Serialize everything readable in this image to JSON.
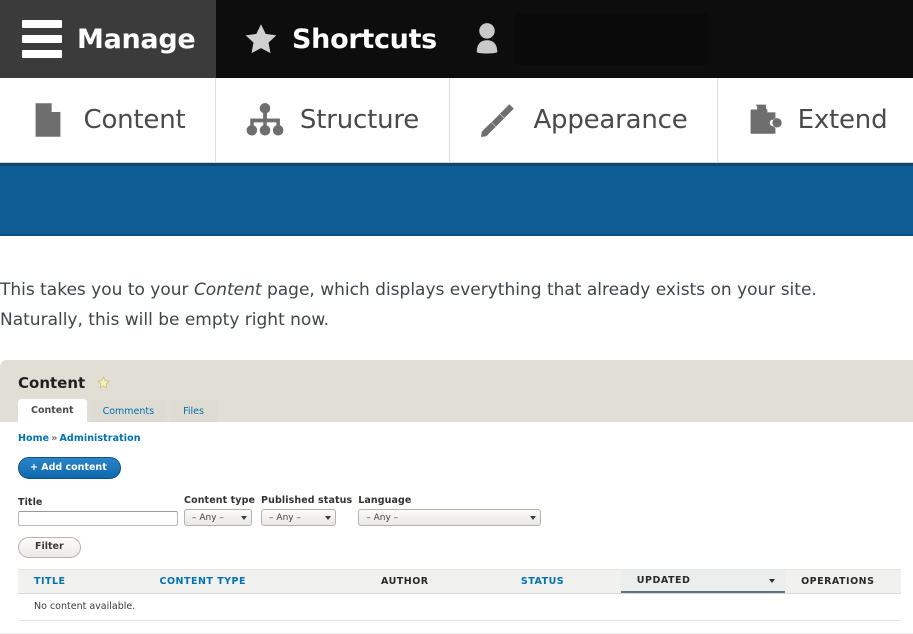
{
  "toolbar": {
    "manage_label": "Manage",
    "manage_icon": "hamburger-menu-icon",
    "shortcuts_label": "Shortcuts",
    "shortcuts_icon": "star-icon",
    "user_icon": "person-icon",
    "username": "",
    "bg_color": "#0d0d0d",
    "manage_bg_color": "#3b3b3b"
  },
  "nav": {
    "items": [
      {
        "label": "Content",
        "icon": "document-icon"
      },
      {
        "label": "Structure",
        "icon": "sitemap-icon"
      },
      {
        "label": "Appearance",
        "icon": "paintbrush-icon"
      },
      {
        "label": "Extend",
        "icon": "puzzle-piece-icon"
      }
    ]
  },
  "banner": {
    "color": "#0e5c94"
  },
  "body": {
    "paragraph_part1": "This takes you to your ",
    "paragraph_emphasis": "Content",
    "paragraph_part2": " page, which displays everything that already exists on your site. Naturally, this will be empty right now."
  },
  "screenshot": {
    "page_title": "Content",
    "favorite_icon": "star-outline-icon",
    "tabs": [
      {
        "label": "Content",
        "active": true
      },
      {
        "label": "Comments",
        "active": false
      },
      {
        "label": "Files",
        "active": false
      }
    ],
    "breadcrumb": {
      "home": "Home",
      "separator": "»",
      "current": "Administration"
    },
    "add_content_label": "+ Add content",
    "filters": {
      "title_label": "Title",
      "title_value": "",
      "content_type_label": "Content type",
      "content_type_value": "– Any –",
      "published_status_label": "Published status",
      "published_status_value": "– Any –",
      "language_label": "Language",
      "language_value": "– Any –",
      "filter_button_label": "Filter"
    },
    "table": {
      "columns": [
        {
          "label": "TITLE",
          "sortable": true,
          "sorted": false
        },
        {
          "label": "CONTENT TYPE",
          "sortable": true,
          "sorted": false
        },
        {
          "label": "AUTHOR",
          "sortable": false,
          "sorted": false
        },
        {
          "label": "STATUS",
          "sortable": true,
          "sorted": false
        },
        {
          "label": "UPDATED",
          "sortable": true,
          "sorted": true
        },
        {
          "label": "OPERATIONS",
          "sortable": false,
          "sorted": false
        }
      ],
      "empty_message": "No content available."
    },
    "accent_link_color": "#0071b3",
    "header_bg_color": "#e0ded5"
  }
}
